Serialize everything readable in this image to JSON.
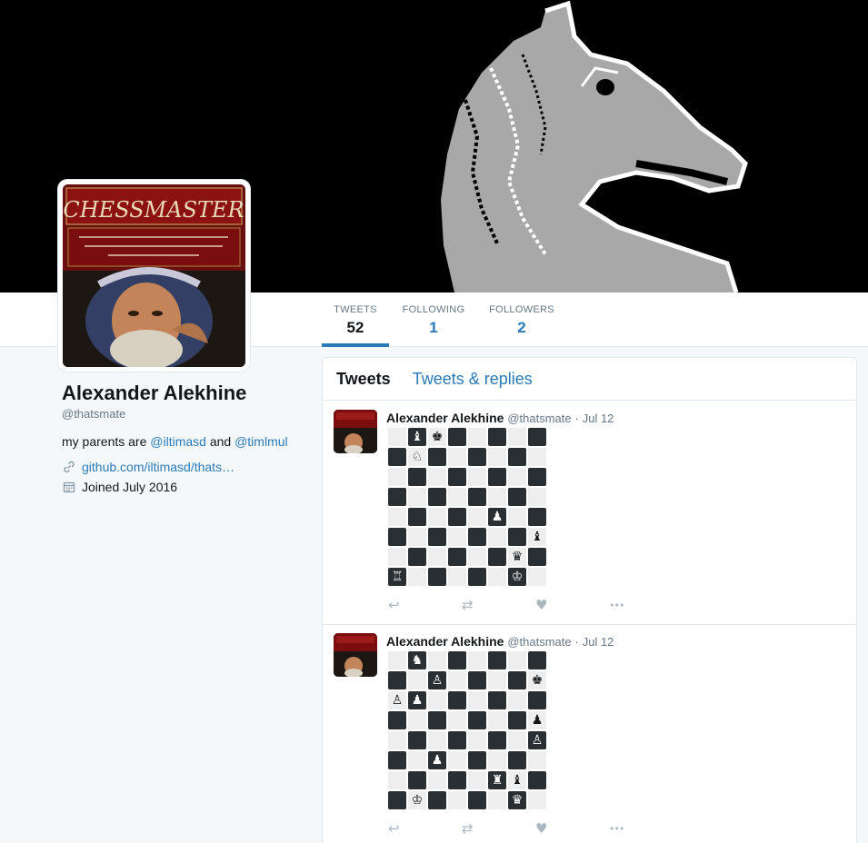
{
  "colors": {
    "accent": "#2b7bb9",
    "text": "#14171a",
    "muted": "#657786",
    "border": "#e1e8ed",
    "page_bg": "#f5f8fa",
    "dark_square": "#292f33",
    "light_square": "#eeeeee"
  },
  "banner": {
    "subject": "pixel-art chess knight on black background"
  },
  "avatar": {
    "title_art": "CHESSMASTER",
    "tagline": "The Ultimate Chess Partner—With 16 Levels of Play to Instruct Beginners and Challenge Grandmasters!"
  },
  "nav": {
    "stats": [
      {
        "label": "TWEETS",
        "value": "52"
      },
      {
        "label": "FOLLOWING",
        "value": "1"
      },
      {
        "label": "FOLLOWERS",
        "value": "2"
      }
    ]
  },
  "profile": {
    "name": "Alexander Alekhine",
    "handle": "@thatsmate",
    "bio_prefix": "my parents are ",
    "bio_link1": "@iltimasd",
    "bio_mid": " and ",
    "bio_link2": "@timlmul",
    "website": "github.com/iltimasd/thats…",
    "joined": "Joined July 2016"
  },
  "timeline": {
    "tabs": [
      {
        "label": "Tweets"
      },
      {
        "label": "Tweets & replies"
      }
    ]
  },
  "tweets": [
    {
      "name": "Alexander Alekhine",
      "handle": "@thatsmate",
      "dot": "·",
      "date": "Jul 12",
      "board": [
        [
          "",
          "♝",
          "♚",
          "",
          "",
          "",
          "",
          ""
        ],
        [
          "",
          "♘",
          "",
          "",
          "",
          "",
          "",
          ""
        ],
        [
          "",
          "",
          "",
          "",
          "",
          "",
          "",
          ""
        ],
        [
          "",
          "",
          "",
          "",
          "",
          "",
          "",
          ""
        ],
        [
          "",
          "",
          "",
          "",
          "",
          "♟",
          "",
          ""
        ],
        [
          "",
          "",
          "",
          "",
          "",
          "",
          "",
          "♝"
        ],
        [
          "",
          "",
          "",
          "",
          "",
          "",
          "♛",
          ""
        ],
        [
          "♖",
          "",
          "",
          "",
          "",
          "",
          "♔",
          ""
        ]
      ]
    },
    {
      "name": "Alexander Alekhine",
      "handle": "@thatsmate",
      "dot": "·",
      "date": "Jul 12",
      "board": [
        [
          "",
          "♞",
          "",
          "",
          "",
          "",
          "",
          ""
        ],
        [
          "",
          "",
          "♙",
          "",
          "",
          "",
          "",
          "♚"
        ],
        [
          "♙",
          "♟",
          "",
          "",
          "",
          "",
          "",
          ""
        ],
        [
          "",
          "",
          "",
          "",
          "",
          "",
          "",
          "♟"
        ],
        [
          "",
          "",
          "",
          "",
          "",
          "",
          "",
          "♙"
        ],
        [
          "",
          "",
          "♟",
          "",
          "",
          "",
          "",
          ""
        ],
        [
          "",
          "",
          "",
          "",
          "",
          "♜",
          "♝",
          ""
        ],
        [
          "",
          "♔",
          "",
          "",
          "",
          "",
          "♛",
          ""
        ]
      ]
    }
  ],
  "tweet_actions": [
    {
      "icon": "reply-icon",
      "glyph": "↩"
    },
    {
      "icon": "retweet-icon",
      "glyph": "⇄"
    },
    {
      "icon": "like-icon",
      "glyph": "♥"
    },
    {
      "icon": "more-icon",
      "glyph": "•••"
    }
  ]
}
